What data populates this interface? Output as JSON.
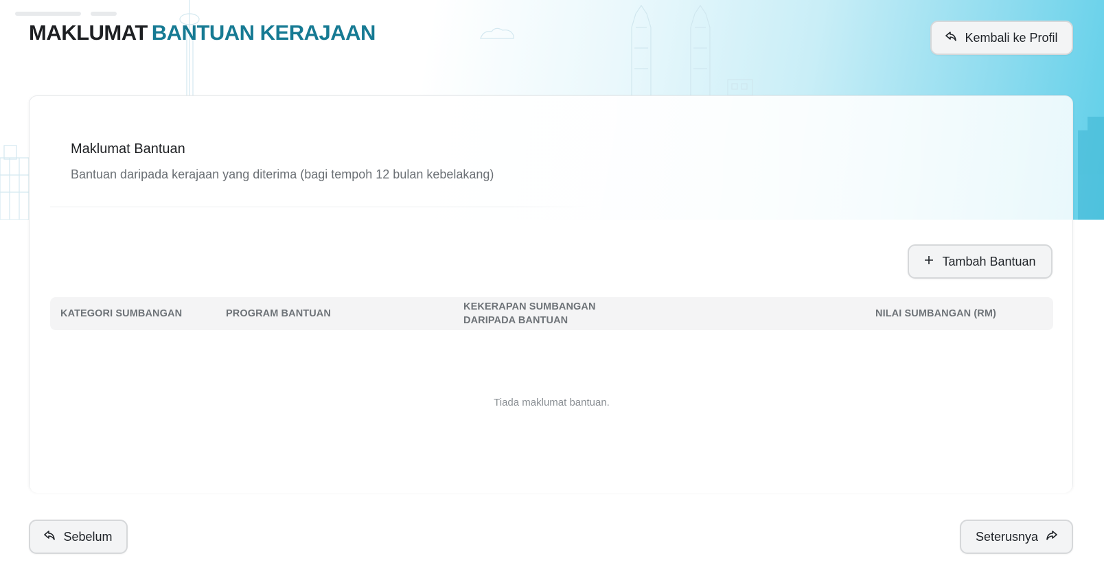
{
  "header": {
    "title_part1": "MAKLUMAT",
    "title_part2": "BANTUAN KERAJAAN",
    "back_button_label": "Kembali ke Profil",
    "back_button_icon": "reply-arrow-icon"
  },
  "section": {
    "title": "Maklumat Bantuan",
    "subtitle": "Bantuan daripada kerajaan yang diterima (bagi tempoh 12 bulan kebelakang)"
  },
  "add_button": {
    "label": "Tambah Bantuan",
    "icon": "plus-icon"
  },
  "table": {
    "columns": [
      "KATEGORI SUMBANGAN",
      "PROGRAM BANTUAN",
      "KEKERAPAN SUMBANGAN DARIPADA BANTUAN",
      "NILAI SUMBANGAN (RM)"
    ],
    "rows": [],
    "empty_message": "Tiada maklumat bantuan."
  },
  "footer": {
    "prev_label": "Sebelum",
    "next_label": "Seterusnya"
  },
  "colors": {
    "accent": "#167a93",
    "hero_gradient_end": "#5fcfe9",
    "button_bg": "#f3f4f5"
  }
}
